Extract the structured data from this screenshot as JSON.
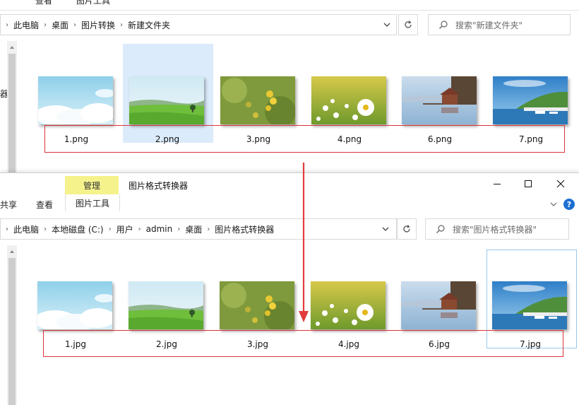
{
  "window1": {
    "ribbon_tabs_cut": [
      "查看",
      "图片工具"
    ],
    "breadcrumb": [
      "此电脑",
      "桌面",
      "图片转换",
      "新建文件夹"
    ],
    "search_placeholder": "搜索\"新建文件夹\"",
    "left_pane_text": "器",
    "files": [
      {
        "name": "1.png",
        "scene": "sky"
      },
      {
        "name": "2.png",
        "scene": "meadow"
      },
      {
        "name": "3.png",
        "scene": "yellow-flowers"
      },
      {
        "name": "4.png",
        "scene": "daisies"
      },
      {
        "name": "6.png",
        "scene": "lake-boathouse"
      },
      {
        "name": "7.png",
        "scene": "harbor"
      }
    ],
    "selected_file": "2.png"
  },
  "window2": {
    "title": "图片格式转换器",
    "tab_manage": "管理",
    "tab_picture_tools": "图片工具",
    "tab_share": "共享",
    "tab_view": "查看",
    "help_label": "?",
    "breadcrumb": [
      "此电脑",
      "本地磁盘 (C:)",
      "用户",
      "admin",
      "桌面",
      "图片格式转换器"
    ],
    "search_placeholder": "搜索\"图片格式转换器\"",
    "files": [
      {
        "name": "1.jpg",
        "scene": "sky"
      },
      {
        "name": "2.jpg",
        "scene": "meadow"
      },
      {
        "name": "3.jpg",
        "scene": "yellow-flowers"
      },
      {
        "name": "4.jpg",
        "scene": "daisies"
      },
      {
        "name": "6.jpg",
        "scene": "lake-boathouse"
      },
      {
        "name": "7.jpg",
        "scene": "harbor"
      }
    ],
    "focused_file": "7.jpg"
  },
  "colors": {
    "highlight_box": "#d9353b",
    "arrow": "#e23c3c",
    "selection": "#dcebfb",
    "manage_tab": "#f5f28c"
  }
}
